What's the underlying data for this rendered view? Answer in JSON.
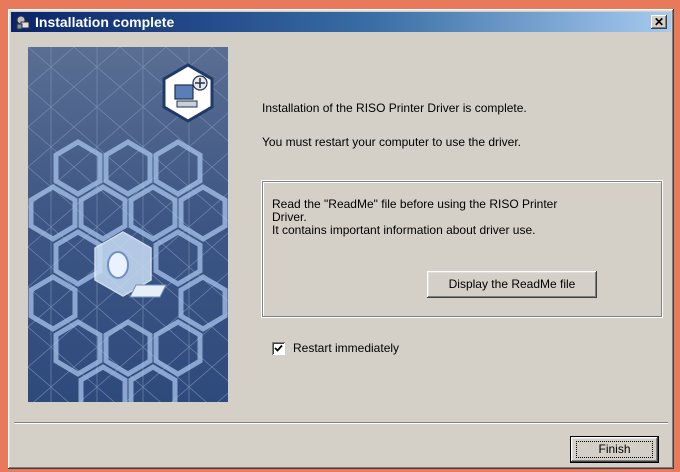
{
  "window": {
    "title": "Installation complete",
    "close_symbol": "✕"
  },
  "icons": {
    "title_icon": "setup-icon",
    "side_badge": "computer-plus-icon",
    "side_device": "printer-cube-icon"
  },
  "messages": {
    "line1": "Installation of the RISO Printer Driver is complete.",
    "line2": "You must restart your computer to use the driver."
  },
  "readme_group": {
    "line1": "Read the \"ReadMe\" file before using the RISO Printer",
    "line2": "Driver.",
    "line3": "It contains important information about driver use.",
    "button_label": "Display the ReadMe file"
  },
  "restart": {
    "label": "Restart immediately",
    "checked": true
  },
  "footer": {
    "finish_label": "Finish"
  },
  "colors": {
    "desktop": "#E8795A",
    "dialog_face": "#D4D0C8",
    "title_start": "#0A246A",
    "title_end": "#A6CAF0",
    "art_blue": "#3C5584"
  }
}
